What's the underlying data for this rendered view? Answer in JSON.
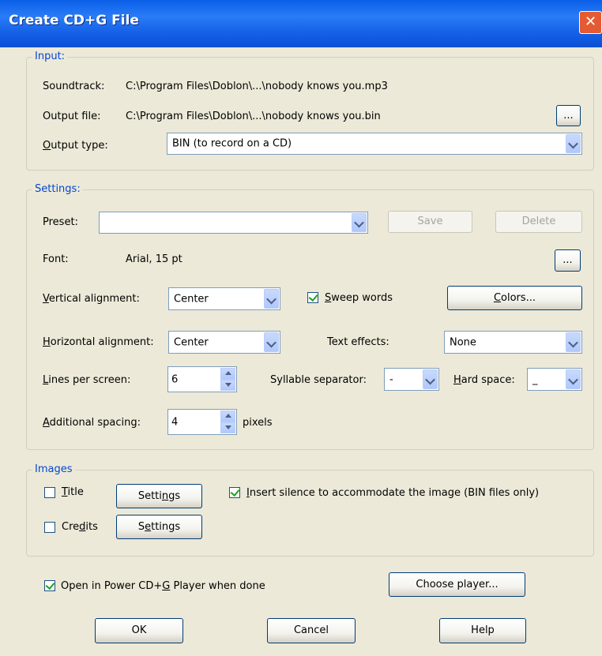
{
  "window": {
    "title": "Create CD+G File",
    "close_glyph": "✕"
  },
  "input": {
    "legend": "Input:",
    "soundtrack_label": "Soundtrack:",
    "soundtrack_value": "C:\\Program Files\\Doblon\\...\\nobody knows you.mp3",
    "output_file_label": "Output file:",
    "output_file_value": "C:\\Program Files\\Doblon\\...\\nobody knows you.bin",
    "browse_label": "...",
    "output_type_label_pre": "",
    "output_type_label_u": "O",
    "output_type_label_post": "utput type:",
    "output_type_value": "BIN (to record on a CD)"
  },
  "settings": {
    "legend": "Settings:",
    "preset_label": "Preset:",
    "preset_value": "",
    "save_label": "Save",
    "delete_label": "Delete",
    "font_label": "Font:",
    "font_value": "Arial, 15 pt",
    "font_browse_label": "...",
    "vertical_label_u": "V",
    "vertical_label_post": "ertical alignment:",
    "vertical_value": "Center",
    "sweep_u": "S",
    "sweep_post": "weep words",
    "sweep_checked": true,
    "colors_u": "C",
    "colors_post": "olors...",
    "horizontal_label_u": "H",
    "horizontal_label_post": "orizontal alignment:",
    "horizontal_value": "Center",
    "text_effects_label": "Text effects:",
    "text_effects_value": "None",
    "lines_label_u": "L",
    "lines_label_post": "ines per screen:",
    "lines_value": "6",
    "syllable_label": "Syllable separator:",
    "syllable_value": "-",
    "hard_space_label_u": "H",
    "hard_space_label_post": "ard space:",
    "hard_space_value": "_",
    "additional_label_u": "A",
    "additional_label_post": "dditional spacing:",
    "additional_value": "4",
    "pixels_label": "pixels"
  },
  "images": {
    "legend": "Images",
    "title_u": "T",
    "title_post": "itle",
    "title_checked": false,
    "title_settings_pre": "Setti",
    "title_settings_u": "n",
    "title_settings_post": "gs",
    "insert_silence_u": "I",
    "insert_silence_post": "nsert silence to accommodate the image (BIN files only)",
    "insert_silence_checked": true,
    "credits_pre": "Cre",
    "credits_u": "d",
    "credits_post": "its",
    "credits_checked": false,
    "credits_settings_pre": "S",
    "credits_settings_u": "e",
    "credits_settings_post": "ttings"
  },
  "footer": {
    "open_player_pre": "Open in Power CD+",
    "open_player_u": "G",
    "open_player_post": " Player when done",
    "open_player_checked": true,
    "choose_player_label": "Choose player...",
    "ok_label": "OK",
    "cancel_label": "Cancel",
    "help_label": "Help"
  }
}
